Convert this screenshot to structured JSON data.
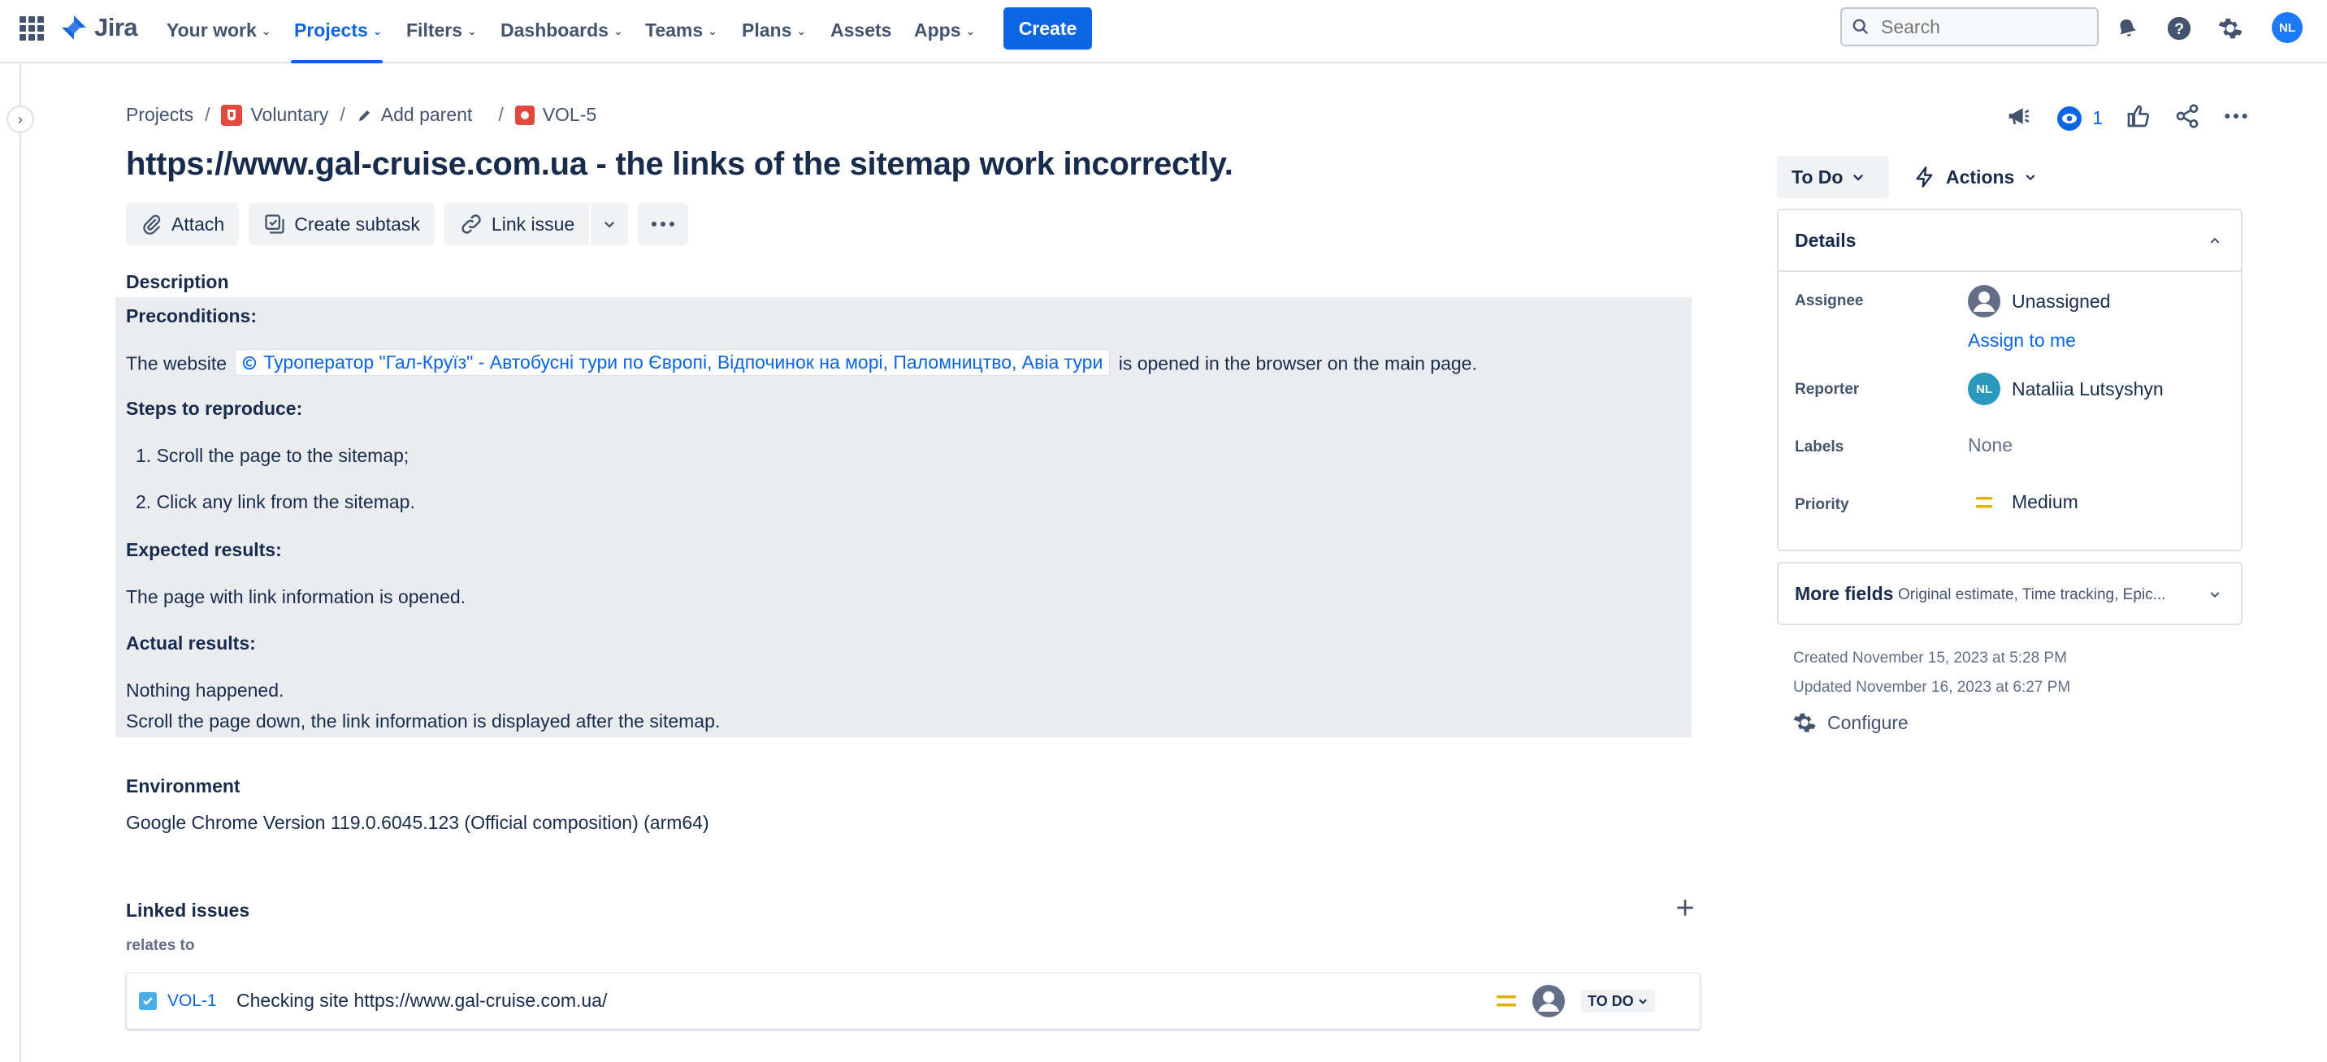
{
  "nav": {
    "logo_text": "Jira",
    "items": [
      {
        "label": "Your work"
      },
      {
        "label": "Projects"
      },
      {
        "label": "Filters"
      },
      {
        "label": "Dashboards"
      },
      {
        "label": "Teams"
      },
      {
        "label": "Plans"
      },
      {
        "label": "Assets"
      },
      {
        "label": "Apps"
      }
    ],
    "create_label": "Create",
    "search_placeholder": "Search",
    "user_initials": "NL"
  },
  "breadcrumb": {
    "projects": "Projects",
    "project_name": "Voluntary",
    "add_parent": "Add parent",
    "issue_key": "VOL-5"
  },
  "watchers_count": "1",
  "issue": {
    "title": "https://www.gal-cruise.com.ua - the links of the sitemap work incorrectly."
  },
  "buttons": {
    "attach": "Attach",
    "create_subtask": "Create subtask",
    "link_issue": "Link issue"
  },
  "description": {
    "heading": "Description",
    "preconditions_label": "Preconditions:",
    "precondition_prefix": "The website",
    "website_link_text": "Туроператор \"Гал-Круїз\" - Автобусні тури по Європі, Відпочинок на морі, Паломництво, Авіа тури",
    "precondition_suffix": "is opened in the browser on the main page.",
    "steps_label": "Steps to reproduce:",
    "steps": [
      "1. Scroll the page to the sitemap;",
      "2. Click any link from the sitemap."
    ],
    "expected_label": "Expected results:",
    "expected_text": "The page with link information is opened.",
    "actual_label": "Actual results:",
    "actual_lines": [
      "Nothing happened.",
      "Scroll the page down, the link information is displayed after the sitemap."
    ]
  },
  "environment": {
    "heading": "Environment",
    "text": "Google Chrome Version 119.0.6045.123 (Official composition) (arm64)"
  },
  "linked_issues": {
    "heading": "Linked issues",
    "relation": "relates to",
    "items": [
      {
        "key": "VOL-1",
        "summary": "Checking site https://www.gal-cruise.com.ua/",
        "status": "TO DO"
      }
    ]
  },
  "sidebar": {
    "status_label": "To Do",
    "actions_label": "Actions",
    "details_title": "Details",
    "fields": {
      "assignee_label": "Assignee",
      "assignee_value": "Unassigned",
      "assign_to_me": "Assign to me",
      "reporter_label": "Reporter",
      "reporter_value": "Nataliia Lutsyshyn",
      "reporter_initials": "NL",
      "labels_label": "Labels",
      "labels_value": "None",
      "priority_label": "Priority",
      "priority_value": "Medium"
    },
    "more_fields_title": "More fields",
    "more_fields_hint": "Original estimate, Time tracking, Epic...",
    "created": "Created November 15, 2023 at 5:28 PM",
    "updated": "Updated November 16, 2023 at 6:27 PM",
    "configure": "Configure"
  },
  "colors": {
    "brand_blue": "#0c66e4",
    "priority_medium": "#e2b203",
    "bug_red": "#e2483d"
  }
}
